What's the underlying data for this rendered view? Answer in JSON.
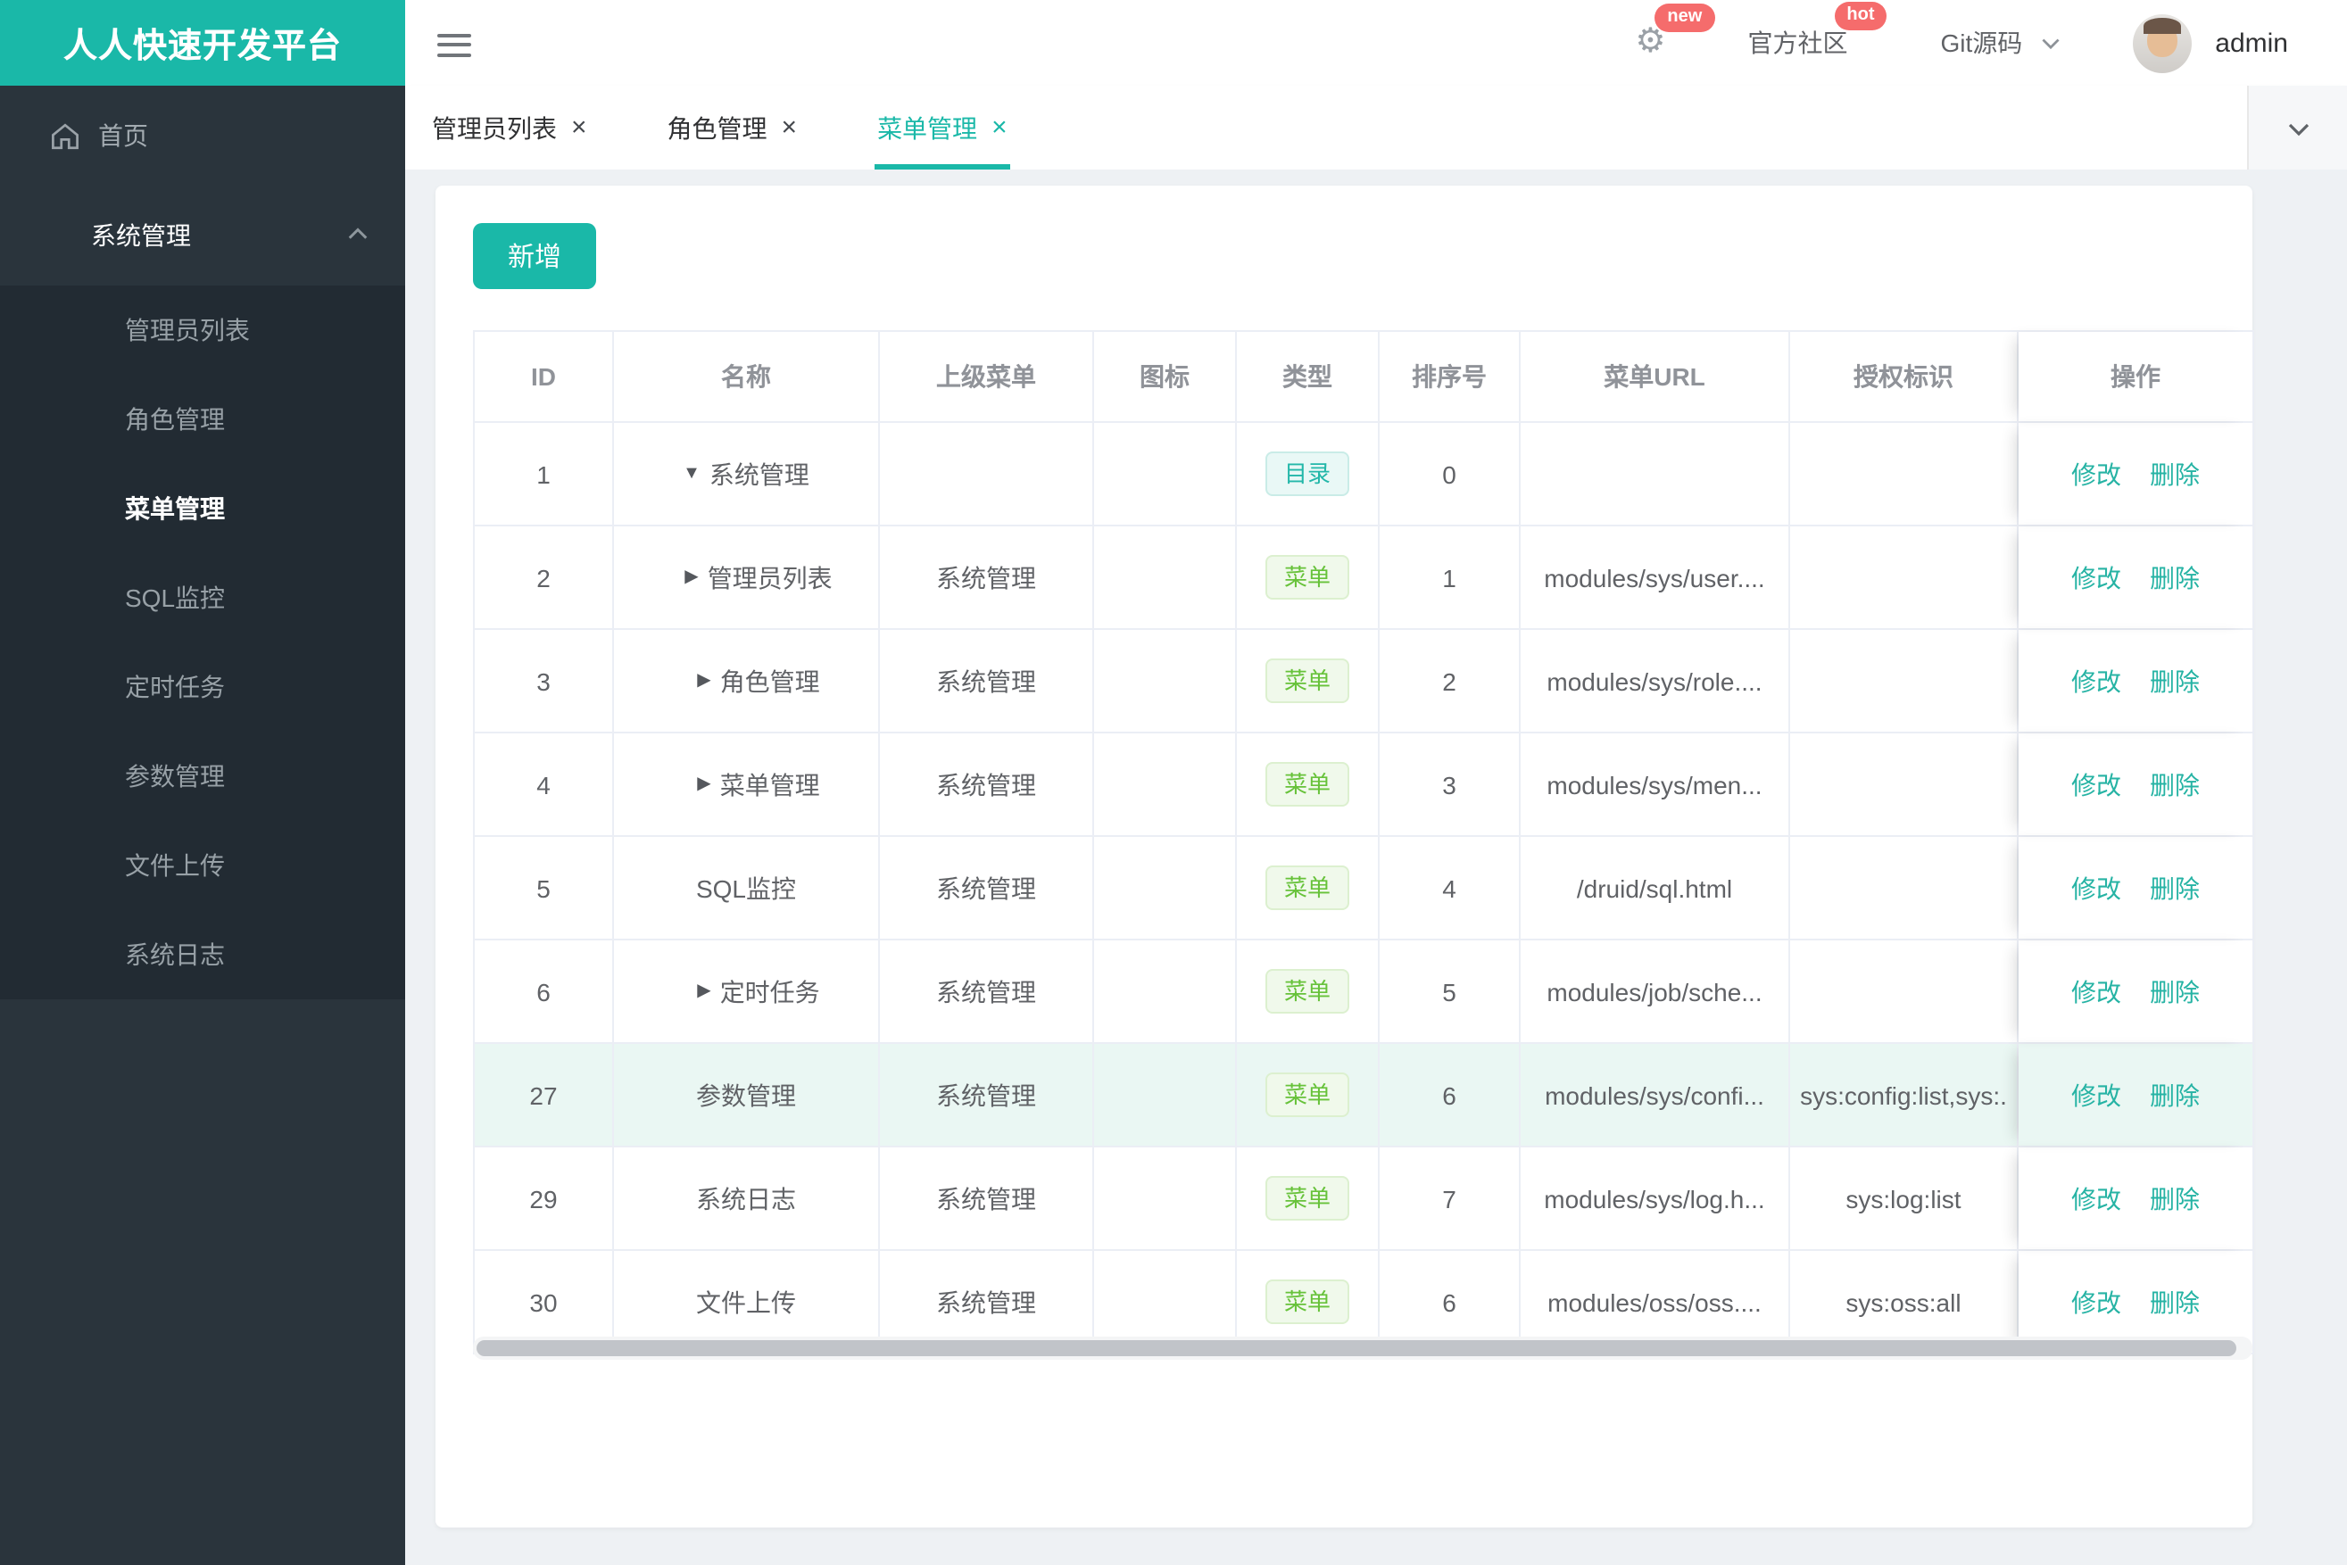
{
  "colors": {
    "brand": "#1ab8a8",
    "badge_red": "#f56c6c",
    "tag_dir": "#23b7a9",
    "tag_menu": "#67c23a",
    "row_highlight": "#eaf7f3"
  },
  "brand": {
    "title": "人人快速开发平台"
  },
  "sidebar": {
    "home_label": "首页",
    "group_label": "系统管理",
    "items": [
      {
        "label": "管理员列表",
        "active": false
      },
      {
        "label": "角色管理",
        "active": false
      },
      {
        "label": "菜单管理",
        "active": true
      },
      {
        "label": "SQL监控",
        "active": false
      },
      {
        "label": "定时任务",
        "active": false
      },
      {
        "label": "参数管理",
        "active": false
      },
      {
        "label": "文件上传",
        "active": false
      },
      {
        "label": "系统日志",
        "active": false
      }
    ]
  },
  "navbar": {
    "badge_new": "new",
    "community_label": "官方社区",
    "badge_hot": "hot",
    "git_label": "Git源码",
    "username": "admin"
  },
  "tabs": [
    {
      "label": "管理员列表",
      "close": "×",
      "active": false
    },
    {
      "label": "角色管理",
      "close": "×",
      "active": false
    },
    {
      "label": "菜单管理",
      "close": "×",
      "active": true
    }
  ],
  "toolbar": {
    "add_label": "新增"
  },
  "table": {
    "columns": [
      "ID",
      "名称",
      "上级菜单",
      "图标",
      "类型",
      "排序号",
      "菜单URL",
      "授权标识",
      "操作"
    ],
    "actions": {
      "edit": "修改",
      "delete": "删除"
    },
    "rows": [
      {
        "id": "1",
        "name": "系统管理",
        "arrow": "down",
        "level": 0,
        "parent": "",
        "type": "目录",
        "type_kind": "dir",
        "order": "0",
        "url": "",
        "perms": "",
        "highlight": false
      },
      {
        "id": "2",
        "name": "管理员列表",
        "arrow": "right",
        "level": 1,
        "parent": "系统管理",
        "type": "菜单",
        "type_kind": "menu",
        "order": "1",
        "url": "modules/sys/user....",
        "perms": "",
        "highlight": false
      },
      {
        "id": "3",
        "name": "角色管理",
        "arrow": "right",
        "level": 1,
        "parent": "系统管理",
        "type": "菜单",
        "type_kind": "menu",
        "order": "2",
        "url": "modules/sys/role....",
        "perms": "",
        "highlight": false
      },
      {
        "id": "4",
        "name": "菜单管理",
        "arrow": "right",
        "level": 1,
        "parent": "系统管理",
        "type": "菜单",
        "type_kind": "menu",
        "order": "3",
        "url": "modules/sys/men...",
        "perms": "",
        "highlight": false
      },
      {
        "id": "5",
        "name": "SQL监控",
        "arrow": "none",
        "level": 1,
        "parent": "系统管理",
        "type": "菜单",
        "type_kind": "menu",
        "order": "4",
        "url": "/druid/sql.html",
        "perms": "",
        "highlight": false
      },
      {
        "id": "6",
        "name": "定时任务",
        "arrow": "right",
        "level": 1,
        "parent": "系统管理",
        "type": "菜单",
        "type_kind": "menu",
        "order": "5",
        "url": "modules/job/sche...",
        "perms": "",
        "highlight": false
      },
      {
        "id": "27",
        "name": "参数管理",
        "arrow": "none",
        "level": 1,
        "parent": "系统管理",
        "type": "菜单",
        "type_kind": "menu",
        "order": "6",
        "url": "modules/sys/confi...",
        "perms": "sys:config:list,sys:.",
        "highlight": true
      },
      {
        "id": "29",
        "name": "系统日志",
        "arrow": "none",
        "level": 1,
        "parent": "系统管理",
        "type": "菜单",
        "type_kind": "menu",
        "order": "7",
        "url": "modules/sys/log.h...",
        "perms": "sys:log:list",
        "highlight": false
      },
      {
        "id": "30",
        "name": "文件上传",
        "arrow": "none",
        "level": 1,
        "parent": "系统管理",
        "type": "菜单",
        "type_kind": "menu",
        "order": "6",
        "url": "modules/oss/oss....",
        "perms": "sys:oss:all",
        "highlight": false
      }
    ]
  }
}
